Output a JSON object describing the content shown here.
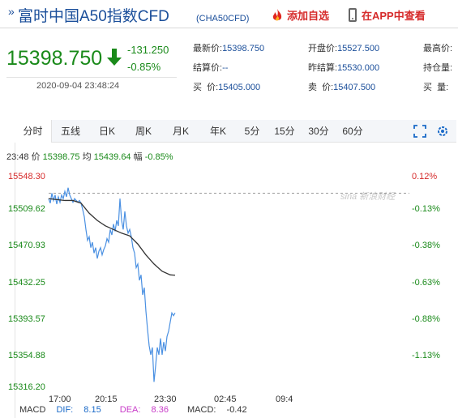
{
  "header": {
    "raquo": "»",
    "title": "富时中国A50指数CFD",
    "code": "(CHA50CFD)",
    "favorite_label": "添加自选",
    "app_label": "在APP中查看"
  },
  "quote": {
    "price": "15398.750",
    "change": "-131.250",
    "change_pct": "-0.85%",
    "datetime": "2020-09-04 23:48:24",
    "color_down": "#1a8a1a",
    "color_up": "#d62b2b"
  },
  "stats": [
    {
      "label": "最新价:",
      "value": "15398.750"
    },
    {
      "label": "开盘价:",
      "value": "15527.500"
    },
    {
      "label": "最高价:",
      "value": ""
    },
    {
      "label": "结算价:",
      "value": "--"
    },
    {
      "label": "昨结算:",
      "value": "15530.000"
    },
    {
      "label": "持仓量:",
      "value": ""
    },
    {
      "label": "买  价:",
      "value": "15405.000"
    },
    {
      "label": "卖  价:",
      "value": "15407.500"
    },
    {
      "label": "买  量:",
      "value": ""
    }
  ],
  "tabs": [
    "分时",
    "日K",
    "周K",
    "月K",
    "年K",
    "5分",
    "15分",
    "30分",
    "60分"
  ],
  "tab_wuxian": "五线",
  "info_bar": {
    "time": "23:48",
    "price_label": "价",
    "price": "15398.75",
    "avg_label": "均",
    "avg": "15439.64",
    "amp_label": "幅",
    "amp": "-0.85%"
  },
  "watermark": "sina 新浪财经",
  "chart_data": {
    "type": "line",
    "y_left_ticks": [
      "15548.30",
      "15509.62",
      "15470.93",
      "15432.25",
      "15393.57",
      "15354.88",
      "15316.20"
    ],
    "y_right_ticks": [
      "0.12%",
      "-0.13%",
      "-0.38%",
      "-0.63%",
      "-0.88%",
      "-1.13%"
    ],
    "x_ticks": [
      "17:00",
      "20:15",
      "23:30",
      "02:45",
      "09:4"
    ],
    "ylim": [
      15316.2,
      15548.3
    ],
    "ref_value": 15530.0,
    "series": [
      {
        "name": "价",
        "color": "#4a90e2",
        "points": [
          [
            0,
            15524
          ],
          [
            2,
            15519
          ],
          [
            4,
            15530
          ],
          [
            6,
            15522
          ],
          [
            8,
            15528
          ],
          [
            10,
            15518
          ],
          [
            12,
            15526
          ],
          [
            14,
            15520
          ],
          [
            16,
            15528
          ],
          [
            18,
            15524
          ],
          [
            20,
            15532
          ],
          [
            22,
            15526
          ],
          [
            24,
            15536
          ],
          [
            26,
            15528
          ],
          [
            28,
            15524
          ],
          [
            30,
            15520
          ],
          [
            32,
            15524
          ],
          [
            34,
            15522
          ],
          [
            36,
            15520
          ],
          [
            38,
            15522
          ],
          [
            40,
            15519
          ],
          [
            42,
            15512
          ],
          [
            44,
            15504
          ],
          [
            46,
            15490
          ],
          [
            48,
            15478
          ],
          [
            50,
            15482
          ],
          [
            52,
            15470
          ],
          [
            54,
            15476
          ],
          [
            56,
            15464
          ],
          [
            58,
            15470
          ],
          [
            60,
            15458
          ],
          [
            62,
            15466
          ],
          [
            64,
            15470
          ],
          [
            66,
            15462
          ],
          [
            68,
            15468
          ],
          [
            70,
            15472
          ],
          [
            72,
            15480
          ],
          [
            74,
            15476
          ],
          [
            76,
            15490
          ],
          [
            78,
            15484
          ],
          [
            80,
            15496
          ],
          [
            82,
            15488
          ],
          [
            84,
            15500
          ],
          [
            86,
            15494
          ],
          [
            88,
            15524
          ],
          [
            90,
            15500
          ],
          [
            92,
            15490
          ],
          [
            94,
            15510
          ],
          [
            96,
            15494
          ],
          [
            98,
            15486
          ],
          [
            100,
            15490
          ],
          [
            102,
            15482
          ],
          [
            104,
            15470
          ],
          [
            106,
            15464
          ],
          [
            108,
            15448
          ],
          [
            110,
            15452
          ],
          [
            112,
            15434
          ],
          [
            114,
            15440
          ],
          [
            116,
            15418
          ],
          [
            118,
            15426
          ],
          [
            120,
            15400
          ],
          [
            122,
            15380
          ],
          [
            124,
            15362
          ],
          [
            126,
            15352
          ],
          [
            128,
            15360
          ],
          [
            130,
            15322
          ],
          [
            132,
            15340
          ],
          [
            134,
            15360
          ],
          [
            136,
            15352
          ],
          [
            138,
            15370
          ],
          [
            140,
            15352
          ],
          [
            142,
            15366
          ],
          [
            144,
            15356
          ],
          [
            146,
            15372
          ],
          [
            148,
            15378
          ],
          [
            150,
            15388
          ],
          [
            152,
            15398
          ],
          [
            154,
            15395
          ],
          [
            156,
            15398
          ]
        ]
      },
      {
        "name": "均",
        "color": "#333333",
        "points": [
          [
            0,
            15524
          ],
          [
            10,
            15523
          ],
          [
            20,
            15522
          ],
          [
            30,
            15522
          ],
          [
            40,
            15519
          ],
          [
            50,
            15508
          ],
          [
            60,
            15500
          ],
          [
            70,
            15494
          ],
          [
            80,
            15490
          ],
          [
            90,
            15486
          ],
          [
            100,
            15483
          ],
          [
            110,
            15474
          ],
          [
            120,
            15462
          ],
          [
            130,
            15452
          ],
          [
            140,
            15444
          ],
          [
            150,
            15440
          ],
          [
            156,
            15439.64
          ]
        ]
      }
    ],
    "x_range": [
      0,
      545
    ]
  },
  "macd": {
    "title": "MACD",
    "dif_label": "DIF:",
    "dif": "8.15",
    "dea_label": "DEA:",
    "dea": "8.36",
    "macd_label": "MACD:",
    "macd": "-0.42"
  }
}
